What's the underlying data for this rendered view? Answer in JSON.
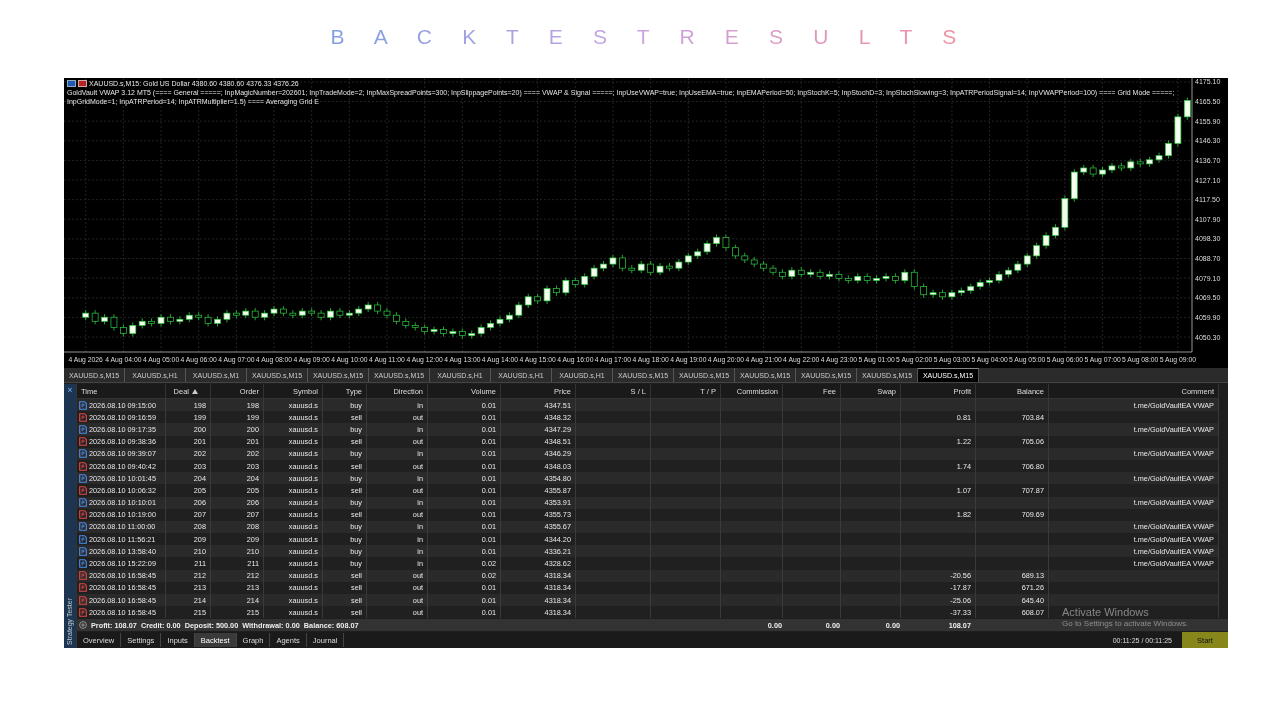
{
  "title": "B A C K T E S T R E S U L T S",
  "chart": {
    "symbol_line": "XAUUSD.s,M15:  Gold US Dollar  4380.60 4380.60 4376.33 4376.26",
    "indicator_line": "GoldVault VWAP 3.12 MT5 (==== General =====; InpMagicNumber=202601; InpTradeMode=2; InpMaxSpreadPoints=300; InpSlippagePoints=20) ==== VWAP & Signal =====; InpUseVWAP=true; InpUseEMA=true; InpEMAPeriod=50; InpStochK=5; InpStochD=3; InpStochSlowing=3; InpATRPeriodSignal=14; InpVWAPPeriod=100) ==== Grid Mode =====; InpGridMode=1; InpATRPeriod=14; InpATRMultiplier=1.5) ==== Averaging Grid E",
    "chart_data": {
      "type": "candlestick",
      "grid": true,
      "ylim": [
        4043,
        4177
      ],
      "categories": [
        "4 Aug 2026",
        null,
        null,
        null,
        "4 Aug 04:00",
        null,
        null,
        null,
        "4 Aug 05:00",
        null,
        null,
        null,
        "4 Aug 06:00",
        null,
        null,
        null,
        "4 Aug 07:00",
        null,
        null,
        null,
        "4 Aug 08:00",
        null,
        null,
        null,
        "4 Aug 09:00",
        null,
        null,
        null,
        "4 Aug 10:00",
        null,
        null,
        null,
        "4 Aug 11:00",
        null,
        null,
        null,
        "4 Aug 12:00",
        null,
        null,
        null,
        "4 Aug 13:00",
        null,
        null,
        null,
        "4 Aug 14:00",
        null,
        null,
        null,
        "4 Aug 15:00",
        null,
        null,
        null,
        "4 Aug 16:00",
        null,
        null,
        null,
        "4 Aug 17:00",
        null,
        null,
        null,
        "4 Aug 18:00",
        null,
        null,
        null,
        "4 Aug 19:00",
        null,
        null,
        null,
        "4 Aug 20:00",
        null,
        null,
        null,
        "4 Aug 21:00",
        null,
        null,
        null,
        "4 Aug 22:00",
        null,
        null,
        null,
        "4 Aug 23:00",
        null,
        null,
        null,
        "5 Aug 01:00",
        null,
        null,
        null,
        "5 Aug 02:00",
        null,
        null,
        null,
        "5 Aug 03:00",
        null,
        null,
        null,
        "5 Aug 04:00",
        null,
        null,
        null,
        "5 Aug 05:00",
        null,
        null,
        null,
        "5 Aug 06:00",
        null,
        null,
        null,
        "5 Aug 07:00",
        null,
        null,
        null,
        "5 Aug 08:00",
        null,
        null,
        null,
        "5 Aug 09:00",
        null
      ],
      "ohlc": [
        [
          4060,
          4063.5,
          4058.5,
          4062
        ],
        [
          4062,
          4063.5,
          4056.5,
          4058
        ],
        [
          4058,
          4061.5,
          4056.5,
          4060
        ],
        [
          4060,
          4061.5,
          4053.5,
          4055
        ],
        [
          4055,
          4056.5,
          4050.5,
          4052
        ],
        [
          4052,
          4057.5,
          4050.5,
          4056
        ],
        [
          4056,
          4059.5,
          4054.5,
          4058
        ],
        [
          4058,
          4059.5,
          4055.5,
          4057
        ],
        [
          4057,
          4061.5,
          4055.5,
          4060
        ],
        [
          4060,
          4061.5,
          4056.5,
          4058
        ],
        [
          4058,
          4060.5,
          4056.5,
          4059
        ],
        [
          4059,
          4062.5,
          4057.5,
          4061
        ],
        [
          4061,
          4062.5,
          4058.5,
          4060
        ],
        [
          4060,
          4061.5,
          4055.5,
          4057
        ],
        [
          4057,
          4060.5,
          4055.5,
          4059
        ],
        [
          4059,
          4063.5,
          4057.5,
          4062
        ],
        [
          4062,
          4063.5,
          4059.5,
          4061
        ],
        [
          4061,
          4064.5,
          4059.5,
          4063
        ],
        [
          4063,
          4064.5,
          4058.5,
          4060
        ],
        [
          4060,
          4063.5,
          4058.5,
          4062
        ],
        [
          4062,
          4065.5,
          4060.5,
          4064
        ],
        [
          4064,
          4065.5,
          4060.5,
          4062
        ],
        [
          4062,
          4063.5,
          4059.5,
          4061
        ],
        [
          4061,
          4064.5,
          4059.5,
          4063
        ],
        [
          4063,
          4064.5,
          4060.5,
          4062
        ],
        [
          4062,
          4063.5,
          4058.5,
          4060
        ],
        [
          4060,
          4064.5,
          4058.5,
          4063
        ],
        [
          4063,
          4064.5,
          4059.5,
          4061
        ],
        [
          4061,
          4063.5,
          4059.5,
          4062
        ],
        [
          4062,
          4065.5,
          4060.5,
          4064
        ],
        [
          4064,
          4067.5,
          4062.5,
          4066
        ],
        [
          4066,
          4067.5,
          4061.5,
          4063
        ],
        [
          4063,
          4064.5,
          4059.5,
          4061
        ],
        [
          4061,
          4062.5,
          4056.5,
          4058
        ],
        [
          4058,
          4059.5,
          4054.5,
          4056
        ],
        [
          4056,
          4057.5,
          4053.5,
          4055
        ],
        [
          4055,
          4056.5,
          4051.5,
          4053
        ],
        [
          4053,
          4055.5,
          4051.5,
          4054
        ],
        [
          4054,
          4055.5,
          4050.5,
          4052
        ],
        [
          4052,
          4054.5,
          4050.5,
          4053
        ],
        [
          4053,
          4054.5,
          4049.5,
          4051
        ],
        [
          4051,
          4053.5,
          4049.5,
          4052
        ],
        [
          4052,
          4056.5,
          4050.5,
          4055
        ],
        [
          4055,
          4058.5,
          4053.5,
          4057
        ],
        [
          4057,
          4060.5,
          4055.5,
          4059
        ],
        [
          4059,
          4062.5,
          4057.5,
          4061
        ],
        [
          4061,
          4067.5,
          4059.5,
          4066
        ],
        [
          4066,
          4071.5,
          4064.5,
          4070
        ],
        [
          4070,
          4071.5,
          4066.5,
          4068
        ],
        [
          4068,
          4075.5,
          4066.5,
          4074
        ],
        [
          4074,
          4075.5,
          4070.5,
          4072
        ],
        [
          4072,
          4079.5,
          4070.5,
          4078
        ],
        [
          4078,
          4079.5,
          4074.5,
          4076
        ],
        [
          4076,
          4081.5,
          4074.5,
          4080
        ],
        [
          4080,
          4085.5,
          4078.5,
          4084
        ],
        [
          4084,
          4087.5,
          4082.5,
          4086
        ],
        [
          4086,
          4090.5,
          4084.5,
          4089
        ],
        [
          4089,
          4090.5,
          4082.5,
          4084
        ],
        [
          4084,
          4085.5,
          4081.5,
          4083
        ],
        [
          4083,
          4087.5,
          4081.5,
          4086
        ],
        [
          4086,
          4087.5,
          4080.5,
          4082
        ],
        [
          4082,
          4086.5,
          4080.5,
          4085
        ],
        [
          4085,
          4086.5,
          4082.5,
          4084
        ],
        [
          4084,
          4088.5,
          4082.5,
          4087
        ],
        [
          4087,
          4091.5,
          4085.5,
          4090
        ],
        [
          4090,
          4093.5,
          4088.5,
          4092
        ],
        [
          4092,
          4097.5,
          4090.5,
          4096
        ],
        [
          4096,
          4100.5,
          4094.5,
          4099
        ],
        [
          4099,
          4100.5,
          4092.5,
          4094
        ],
        [
          4094,
          4095.5,
          4088.5,
          4090
        ],
        [
          4090,
          4091.5,
          4086.5,
          4088
        ],
        [
          4088,
          4089.5,
          4084.5,
          4086
        ],
        [
          4086,
          4087.5,
          4082.5,
          4084
        ],
        [
          4084,
          4085.5,
          4080.5,
          4082
        ],
        [
          4082,
          4083.5,
          4078.5,
          4080
        ],
        [
          4080,
          4084.5,
          4078.5,
          4083
        ],
        [
          4083,
          4084.5,
          4079.5,
          4081
        ],
        [
          4081,
          4083.5,
          4079.5,
          4082
        ],
        [
          4082,
          4083.5,
          4078.5,
          4080
        ],
        [
          4080,
          4082.5,
          4078.5,
          4081
        ],
        [
          4081,
          4082.5,
          4077.5,
          4079
        ],
        [
          4079,
          4080.5,
          4076.5,
          4078
        ],
        [
          4078,
          4081.5,
          4076.5,
          4080
        ],
        [
          4080,
          4081.5,
          4076.5,
          4078
        ],
        [
          4078,
          4080.5,
          4076.5,
          4079
        ],
        [
          4079,
          4081.5,
          4077.5,
          4080
        ],
        [
          4080,
          4081.5,
          4076.5,
          4078
        ],
        [
          4078,
          4083.5,
          4076.5,
          4082
        ],
        [
          4082,
          4083.5,
          4073.5,
          4075
        ],
        [
          4075,
          4076.5,
          4069.5,
          4071
        ],
        [
          4071,
          4073.5,
          4069.5,
          4072
        ],
        [
          4072,
          4073.5,
          4068.5,
          4070
        ],
        [
          4070,
          4073.5,
          4068.5,
          4072
        ],
        [
          4072,
          4074.5,
          4070.5,
          4073
        ],
        [
          4073,
          4076.5,
          4071.5,
          4075
        ],
        [
          4075,
          4078.5,
          4073.5,
          4077
        ],
        [
          4077,
          4079.5,
          4075.5,
          4078
        ],
        [
          4078,
          4082.5,
          4076.5,
          4081
        ],
        [
          4081,
          4084.5,
          4079.5,
          4083
        ],
        [
          4083,
          4087.5,
          4081.5,
          4086
        ],
        [
          4086,
          4091.5,
          4084.5,
          4090
        ],
        [
          4090,
          4096.5,
          4088.5,
          4095
        ],
        [
          4095,
          4101.5,
          4093.5,
          4100
        ],
        [
          4100,
          4105.5,
          4098.5,
          4104
        ],
        [
          4104,
          4119.5,
          4102.5,
          4118
        ],
        [
          4118,
          4132.5,
          4116.5,
          4131
        ],
        [
          4131,
          4134.5,
          4129.5,
          4133
        ],
        [
          4133,
          4134.5,
          4128.5,
          4130
        ],
        [
          4130,
          4133.5,
          4128.5,
          4132
        ],
        [
          4132,
          4135.5,
          4130.5,
          4134
        ],
        [
          4134,
          4135.5,
          4131.5,
          4133
        ],
        [
          4133,
          4137.5,
          4131.5,
          4136
        ],
        [
          4136,
          4137.5,
          4133.5,
          4135
        ],
        [
          4135,
          4138.5,
          4133.5,
          4137
        ],
        [
          4137,
          4140.5,
          4135.5,
          4139
        ],
        [
          4139,
          4146.5,
          4137.5,
          4145
        ],
        [
          4145,
          4159.5,
          4143.5,
          4158
        ],
        [
          4158,
          4167.5,
          4156.5,
          4166
        ]
      ],
      "yticks": [
        {
          "value": 4175.1,
          "label": "4175.10"
        },
        {
          "value": 4165.5,
          "label": "4165.50"
        },
        {
          "value": 4155.9,
          "label": "4155.90"
        },
        {
          "value": 4146.3,
          "label": "4146.30"
        },
        {
          "value": 4136.7,
          "label": "4136.70"
        },
        {
          "value": 4127.1,
          "label": "4127.10"
        },
        {
          "value": 4117.5,
          "label": "4117.50"
        },
        {
          "value": 4107.9,
          "label": "4107.90"
        },
        {
          "value": 4098.3,
          "label": "4098.30"
        },
        {
          "value": 4088.7,
          "label": "4088.70"
        },
        {
          "value": 4079.1,
          "label": "4079.10"
        },
        {
          "value": 4069.5,
          "label": "4069.50"
        },
        {
          "value": 4059.9,
          "label": "4059.90"
        },
        {
          "value": 4050.3,
          "label": "4050.30"
        }
      ]
    }
  },
  "chart_tabs": [
    {
      "label": "XAUUSD.s,M15",
      "selected": false
    },
    {
      "label": "XAUUSD.s,H1",
      "selected": false
    },
    {
      "label": "XAUUSD.s,M1",
      "selected": false
    },
    {
      "label": "XAUUSD.s,M15",
      "selected": false
    },
    {
      "label": "XAUUSD.s,M15",
      "selected": false
    },
    {
      "label": "XAUUSD.s,M15",
      "selected": false
    },
    {
      "label": "XAUUSD.s,H1",
      "selected": false
    },
    {
      "label": "XAUUSD.s,H1",
      "selected": false
    },
    {
      "label": "XAUUSD.s,H1",
      "selected": false
    },
    {
      "label": "XAUUSD.s,M15",
      "selected": false
    },
    {
      "label": "XAUUSD.s,M15",
      "selected": false
    },
    {
      "label": "XAUUSD.s,M15",
      "selected": false
    },
    {
      "label": "XAUUSD.s,M15",
      "selected": false
    },
    {
      "label": "XAUUSD.s,M15",
      "selected": false
    },
    {
      "label": "XAUUSD.s,M15",
      "selected": true
    }
  ],
  "tester": {
    "close_glyph": "×",
    "panel_label": "Strategy Tester",
    "columns": [
      "Time",
      "Deal",
      "Order",
      "Symbol",
      "Type",
      "Direction",
      "Volume",
      "Price",
      "S / L",
      "T / P",
      "Commission",
      "Fee",
      "Swap",
      "Profit",
      "Balance",
      "Comment"
    ],
    "rows": [
      {
        "kind": "buy",
        "time": "2026.08.10 09:15:00",
        "deal": "198",
        "order": "198",
        "symbol": "xauusd.s",
        "type": "buy",
        "direction": "in",
        "volume": "0.01",
        "price": "4347.51",
        "comment": "t.me/GoldVaultEA VWAP"
      },
      {
        "kind": "sell",
        "time": "2026.08.10 09:16:59",
        "deal": "199",
        "order": "199",
        "symbol": "xauusd.s",
        "type": "sell",
        "direction": "out",
        "volume": "0.01",
        "price": "4348.32",
        "profit": "0.81",
        "balance": "703.84"
      },
      {
        "kind": "buy",
        "time": "2026.08.10 09:17:35",
        "deal": "200",
        "order": "200",
        "symbol": "xauusd.s",
        "type": "buy",
        "direction": "in",
        "volume": "0.01",
        "price": "4347.29",
        "comment": "t.me/GoldVaultEA VWAP"
      },
      {
        "kind": "sell",
        "time": "2026.08.10 09:38:36",
        "deal": "201",
        "order": "201",
        "symbol": "xauusd.s",
        "type": "sell",
        "direction": "out",
        "volume": "0.01",
        "price": "4348.51",
        "profit": "1.22",
        "balance": "705.06"
      },
      {
        "kind": "buy",
        "time": "2026.08.10 09:39:07",
        "deal": "202",
        "order": "202",
        "symbol": "xauusd.s",
        "type": "buy",
        "direction": "in",
        "volume": "0.01",
        "price": "4346.29",
        "comment": "t.me/GoldVaultEA VWAP"
      },
      {
        "kind": "sell",
        "time": "2026.08.10 09:40:42",
        "deal": "203",
        "order": "203",
        "symbol": "xauusd.s",
        "type": "sell",
        "direction": "out",
        "volume": "0.01",
        "price": "4348.03",
        "profit": "1.74",
        "balance": "706.80"
      },
      {
        "kind": "buy",
        "time": "2026.08.10 10:01:45",
        "deal": "204",
        "order": "204",
        "symbol": "xauusd.s",
        "type": "buy",
        "direction": "in",
        "volume": "0.01",
        "price": "4354.80",
        "comment": "t.me/GoldVaultEA VWAP"
      },
      {
        "kind": "sell",
        "time": "2026.08.10 10:06:32",
        "deal": "205",
        "order": "205",
        "symbol": "xauusd.s",
        "type": "sell",
        "direction": "out",
        "volume": "0.01",
        "price": "4355.87",
        "profit": "1.07",
        "balance": "707.87"
      },
      {
        "kind": "buy",
        "time": "2026.08.10 10:10:01",
        "deal": "206",
        "order": "206",
        "symbol": "xauusd.s",
        "type": "buy",
        "direction": "in",
        "volume": "0.01",
        "price": "4353.91",
        "comment": "t.me/GoldVaultEA VWAP"
      },
      {
        "kind": "sell",
        "time": "2026.08.10 10:19:00",
        "deal": "207",
        "order": "207",
        "symbol": "xauusd.s",
        "type": "sell",
        "direction": "out",
        "volume": "0.01",
        "price": "4355.73",
        "profit": "1.82",
        "balance": "709.69"
      },
      {
        "kind": "buy",
        "time": "2026.08.10 11:00:00",
        "deal": "208",
        "order": "208",
        "symbol": "xauusd.s",
        "type": "buy",
        "direction": "in",
        "volume": "0.01",
        "price": "4355.67",
        "comment": "t.me/GoldVaultEA VWAP"
      },
      {
        "kind": "buy",
        "time": "2026.08.10 11:56:21",
        "deal": "209",
        "order": "209",
        "symbol": "xauusd.s",
        "type": "buy",
        "direction": "in",
        "volume": "0.01",
        "price": "4344.20",
        "comment": "t.me/GoldVaultEA VWAP"
      },
      {
        "kind": "buy",
        "time": "2026.08.10 13:58:40",
        "deal": "210",
        "order": "210",
        "symbol": "xauusd.s",
        "type": "buy",
        "direction": "in",
        "volume": "0.01",
        "price": "4336.21",
        "comment": "t.me/GoldVaultEA VWAP"
      },
      {
        "kind": "buy",
        "time": "2026.08.10 15:22:09",
        "deal": "211",
        "order": "211",
        "symbol": "xauusd.s",
        "type": "buy",
        "direction": "in",
        "volume": "0.02",
        "price": "4328.62",
        "comment": "t.me/GoldVaultEA VWAP"
      },
      {
        "kind": "sell",
        "time": "2026.08.10 16:58:45",
        "deal": "212",
        "order": "212",
        "symbol": "xauusd.s",
        "type": "sell",
        "direction": "out",
        "volume": "0.02",
        "price": "4318.34",
        "profit": "-20.56",
        "balance": "689.13"
      },
      {
        "kind": "sell",
        "time": "2026.08.10 16:58:45",
        "deal": "213",
        "order": "213",
        "symbol": "xauusd.s",
        "type": "sell",
        "direction": "out",
        "volume": "0.01",
        "price": "4318.34",
        "profit": "-17.87",
        "balance": "671.26"
      },
      {
        "kind": "sell",
        "time": "2026.08.10 16:58:45",
        "deal": "214",
        "order": "214",
        "symbol": "xauusd.s",
        "type": "sell",
        "direction": "out",
        "volume": "0.01",
        "price": "4318.34",
        "profit": "-25.06",
        "balance": "645.40"
      },
      {
        "kind": "sell",
        "time": "2026.08.10 16:58:45",
        "deal": "215",
        "order": "215",
        "symbol": "xauusd.s",
        "type": "sell",
        "direction": "out",
        "volume": "0.01",
        "price": "4318.34",
        "profit": "-37.33",
        "balance": "608.07"
      }
    ],
    "summary": {
      "text": "Profit: 108.07  Credit: 0.00  Deposit: 500.00  Withdrawal: 0.00  Balance: 608.07",
      "commission": "0.00",
      "fee": "0.00",
      "swap": "0.00",
      "profit": "108.07"
    },
    "bottom_tabs": [
      {
        "label": "Overview",
        "selected": false
      },
      {
        "label": "Settings",
        "selected": false
      },
      {
        "label": "Inputs",
        "selected": false
      },
      {
        "label": "Backtest",
        "selected": true
      },
      {
        "label": "Graph",
        "selected": false
      },
      {
        "label": "Agents",
        "selected": false
      },
      {
        "label": "Journal",
        "selected": false
      }
    ],
    "elapsed": "00:11:25 / 00:11:25",
    "start_button": "Start"
  },
  "os_notice": {
    "title": "Activate Windows",
    "subtitle": "Go to Settings to activate Windows."
  }
}
